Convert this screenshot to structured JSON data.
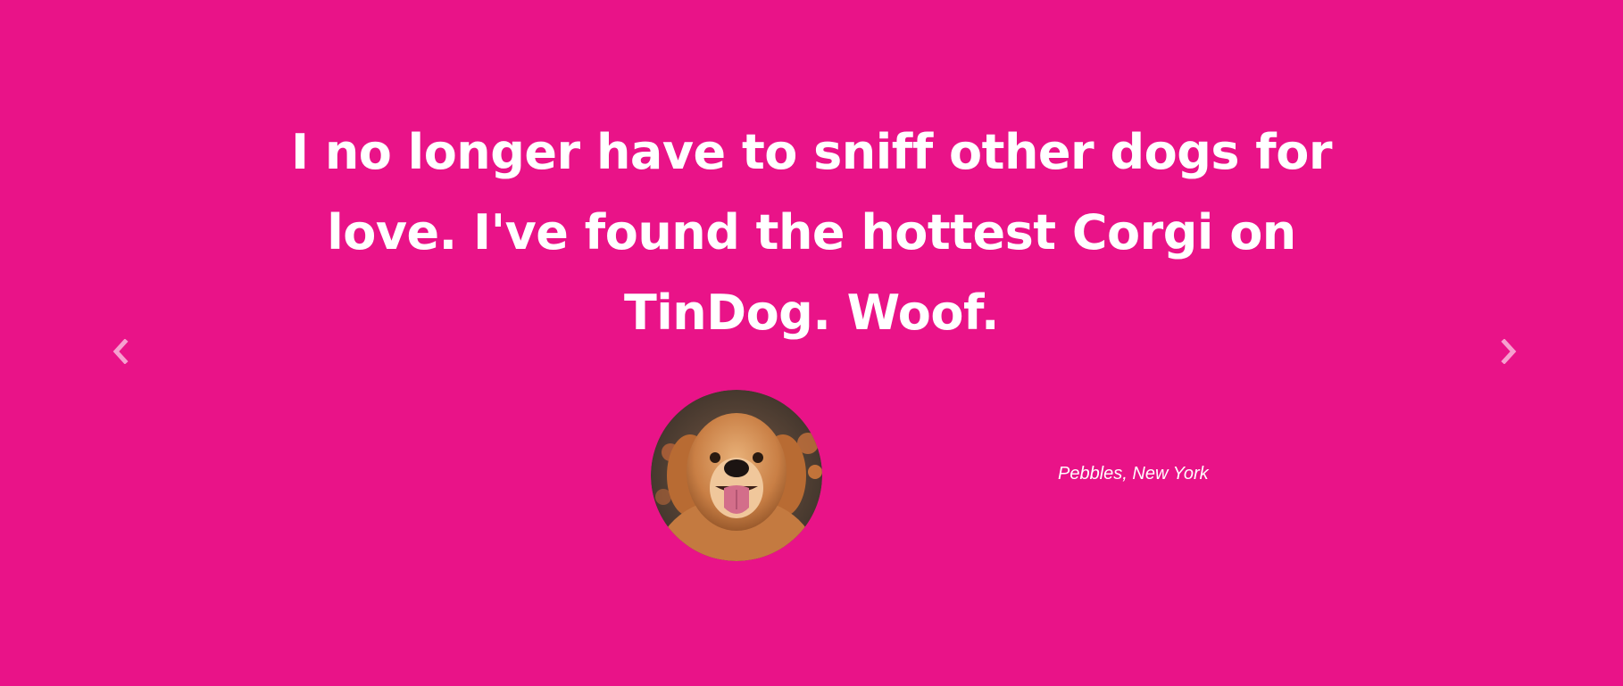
{
  "testimonial": {
    "quote": "I no longer have to sniff other dogs for love. I've found the hottest Corgi on TinDog. Woof.",
    "author": "Pebbles, New York",
    "avatar_icon": "golden-retriever-photo"
  },
  "carousel": {
    "prev_icon": "chevron-left-icon",
    "next_icon": "chevron-right-icon"
  },
  "colors": {
    "background": "#E91388",
    "text": "#FFFFFF"
  }
}
